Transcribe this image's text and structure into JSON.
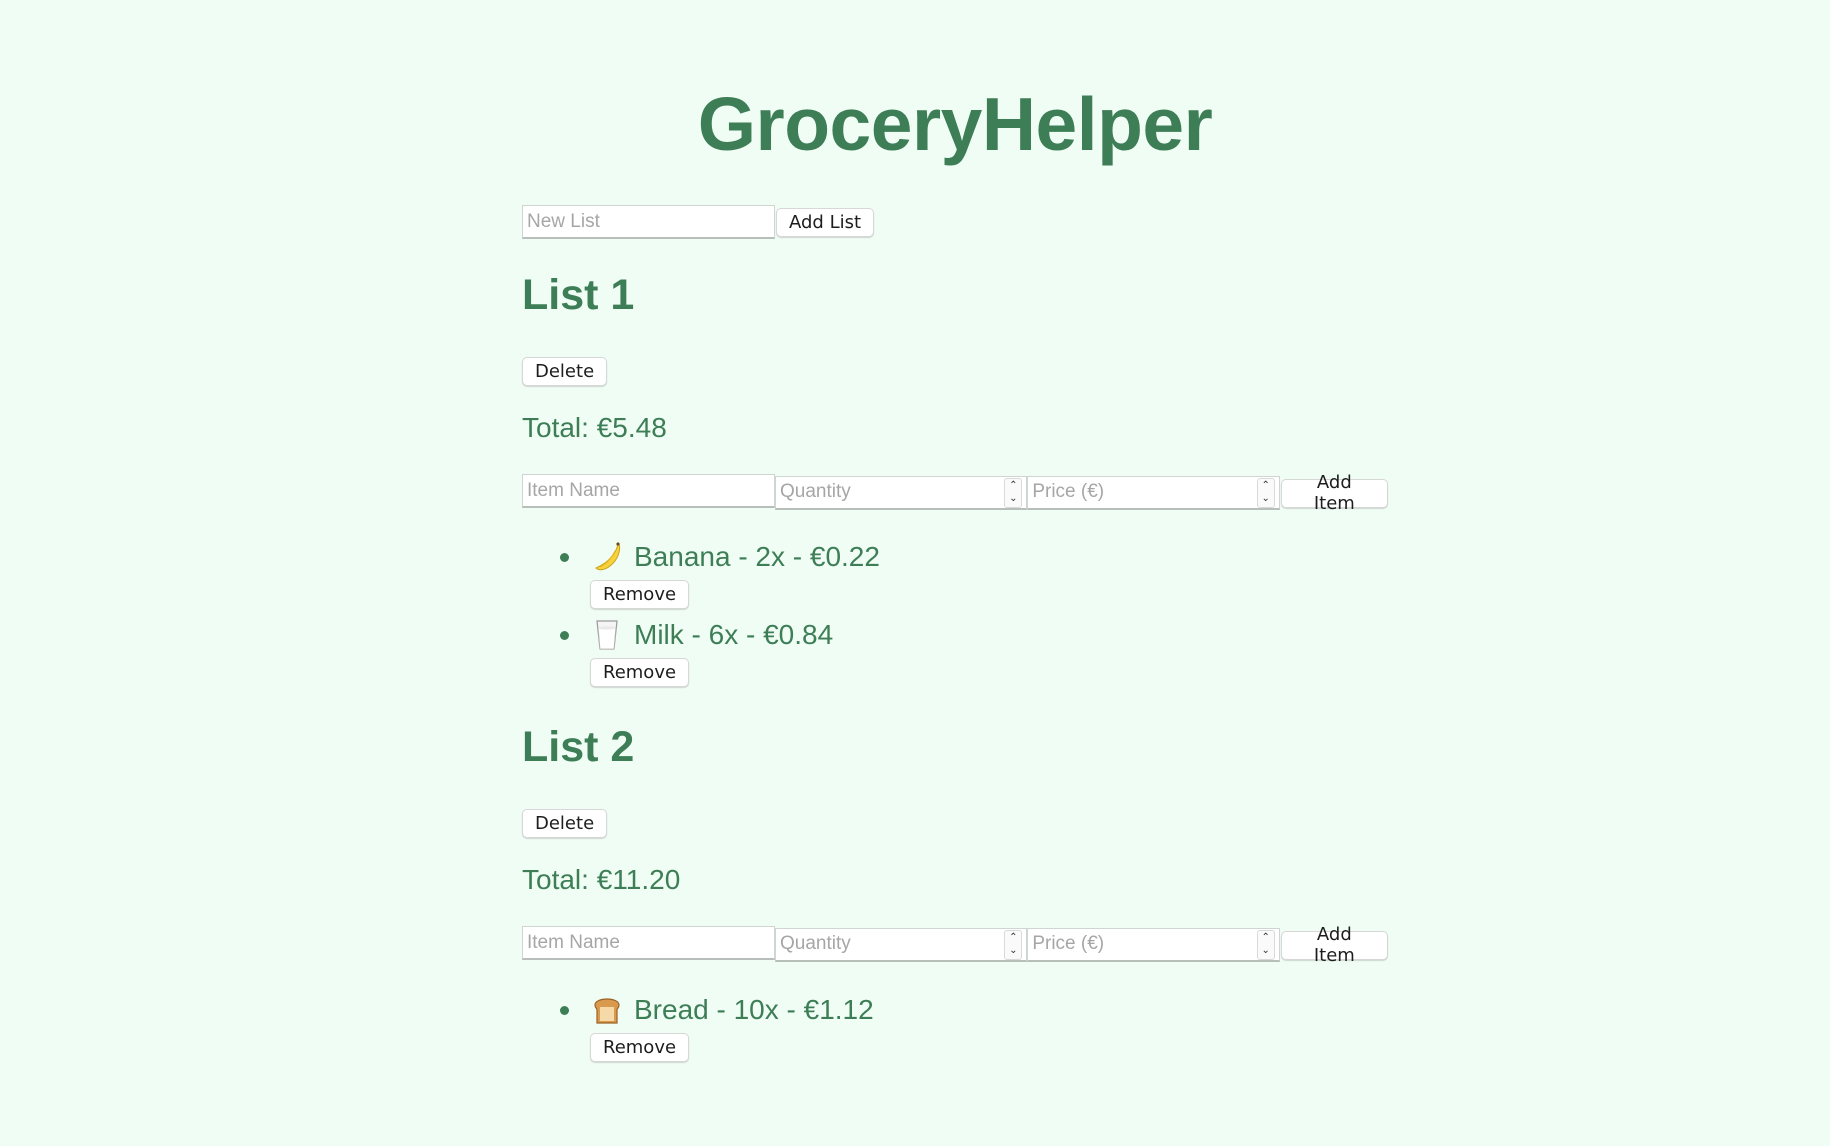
{
  "app": {
    "title": "GroceryHelper"
  },
  "new_list": {
    "placeholder": "New List",
    "add_label": "Add List"
  },
  "lists": [
    {
      "name": "List 1",
      "delete_label": "Delete",
      "total": "Total: €5.48",
      "form": {
        "item_placeholder": "Item Name",
        "quantity_placeholder": "Quantity",
        "price_placeholder": "Price (€)",
        "add_label": "Add Item"
      },
      "items": [
        {
          "icon": "banana-icon",
          "text": "Banana - 2x - €0.22",
          "remove_label": "Remove"
        },
        {
          "icon": "milk-icon",
          "text": "Milk - 6x - €0.84",
          "remove_label": "Remove"
        }
      ]
    },
    {
      "name": "List 2",
      "delete_label": "Delete",
      "total": "Total: €11.20",
      "form": {
        "item_placeholder": "Item Name",
        "quantity_placeholder": "Quantity",
        "price_placeholder": "Price (€)",
        "add_label": "Add Item"
      },
      "items": [
        {
          "icon": "bread-icon",
          "text": "Bread - 10x - €1.12",
          "remove_label": "Remove"
        }
      ]
    }
  ],
  "colors": {
    "background": "#f0fdf4",
    "accent": "#3d7e57"
  }
}
